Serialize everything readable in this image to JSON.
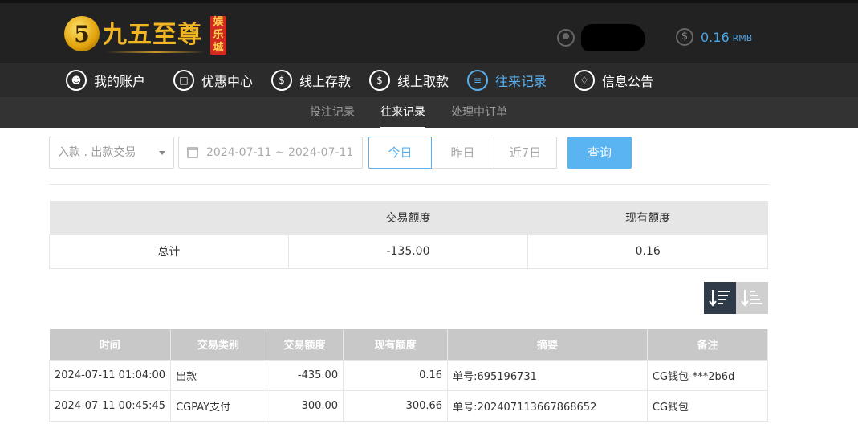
{
  "header": {
    "logo_text": "九五至尊",
    "logo_badge": "娱乐城",
    "balance_value": "0.16",
    "balance_unit": "RMB"
  },
  "nav": {
    "items": [
      {
        "label": "我的账户",
        "icon": "user-icon"
      },
      {
        "label": "优惠中心",
        "icon": "gift-icon"
      },
      {
        "label": "线上存款",
        "icon": "deposit-icon"
      },
      {
        "label": "线上取款",
        "icon": "withdraw-icon"
      },
      {
        "label": "往来记录",
        "icon": "record-icon",
        "active": true
      },
      {
        "label": "信息公告",
        "icon": "bell-icon"
      }
    ]
  },
  "subnav": {
    "items": [
      {
        "label": "投注记录"
      },
      {
        "label": "往来记录",
        "active": true
      },
      {
        "label": "处理中订单"
      }
    ]
  },
  "filter": {
    "type_select": "入款 . 出款交易",
    "date_range": "2024-07-11 ~ 2024-07-11",
    "quick": [
      "今日",
      "昨日",
      "近7日"
    ],
    "query_label": "查询"
  },
  "summary": {
    "headers": [
      "",
      "交易额度",
      "现有额度"
    ],
    "row": [
      "总计",
      "-135.00",
      "0.16"
    ]
  },
  "records": {
    "headers": [
      "时间",
      "交易类别",
      "交易额度",
      "现有额度",
      "摘要",
      "备注"
    ],
    "rows": [
      [
        "2024-07-11 01:04:00",
        "出款",
        "-435.00",
        "0.16",
        "单号:695196731",
        "CG钱包-***2b6d"
      ],
      [
        "2024-07-11 00:45:45",
        "CGPAY支付",
        "300.00",
        "300.66",
        "单号:202407113667868652",
        "CG钱包"
      ]
    ]
  },
  "colors": {
    "accent": "#5ab0ee",
    "logo_gold": "#f2b622",
    "header_bg": "#222222"
  }
}
